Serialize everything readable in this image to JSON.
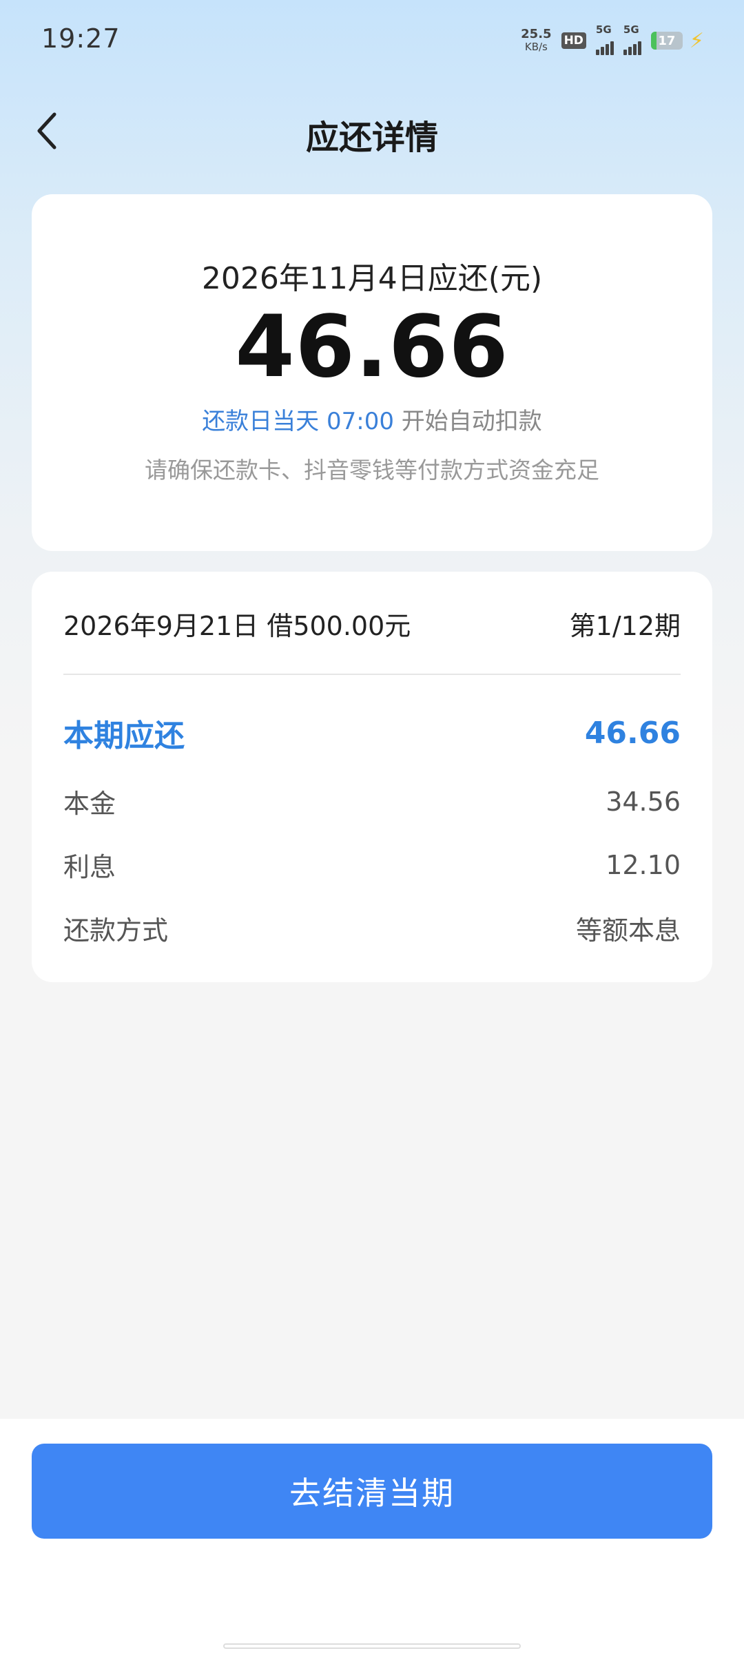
{
  "status_bar": {
    "time": "19:27",
    "net_speed_value": "25.5",
    "net_speed_unit": "KB/s",
    "hd_label": "HD",
    "sim1_label": "5G",
    "sim2_label": "5G",
    "battery_level": "17",
    "battery_percent": 17
  },
  "header": {
    "title": "应还详情",
    "back_icon": "chevron-left-icon"
  },
  "summary": {
    "due_label": "2026年11月4日应还(元)",
    "amount": "46.66",
    "auto_debit_highlight": "还款日当天 07:00",
    "auto_debit_text": " 开始自动扣款",
    "note": "请确保还款卡、抖音零钱等付款方式资金充足"
  },
  "detail": {
    "loan_info": "2026年9月21日 借500.00元",
    "period": "第1/12期",
    "due_label": "本期应还",
    "due_value": "46.66",
    "principal_label": "本金",
    "principal_value": "34.56",
    "interest_label": "利息",
    "interest_value": "12.10",
    "method_label": "还款方式",
    "method_value": "等额本息"
  },
  "footer": {
    "button_label": "去结清当期"
  },
  "colors": {
    "accent": "#3f86f4",
    "highlight_text": "#2f82e0",
    "battery_fill": "#4cc15b"
  }
}
